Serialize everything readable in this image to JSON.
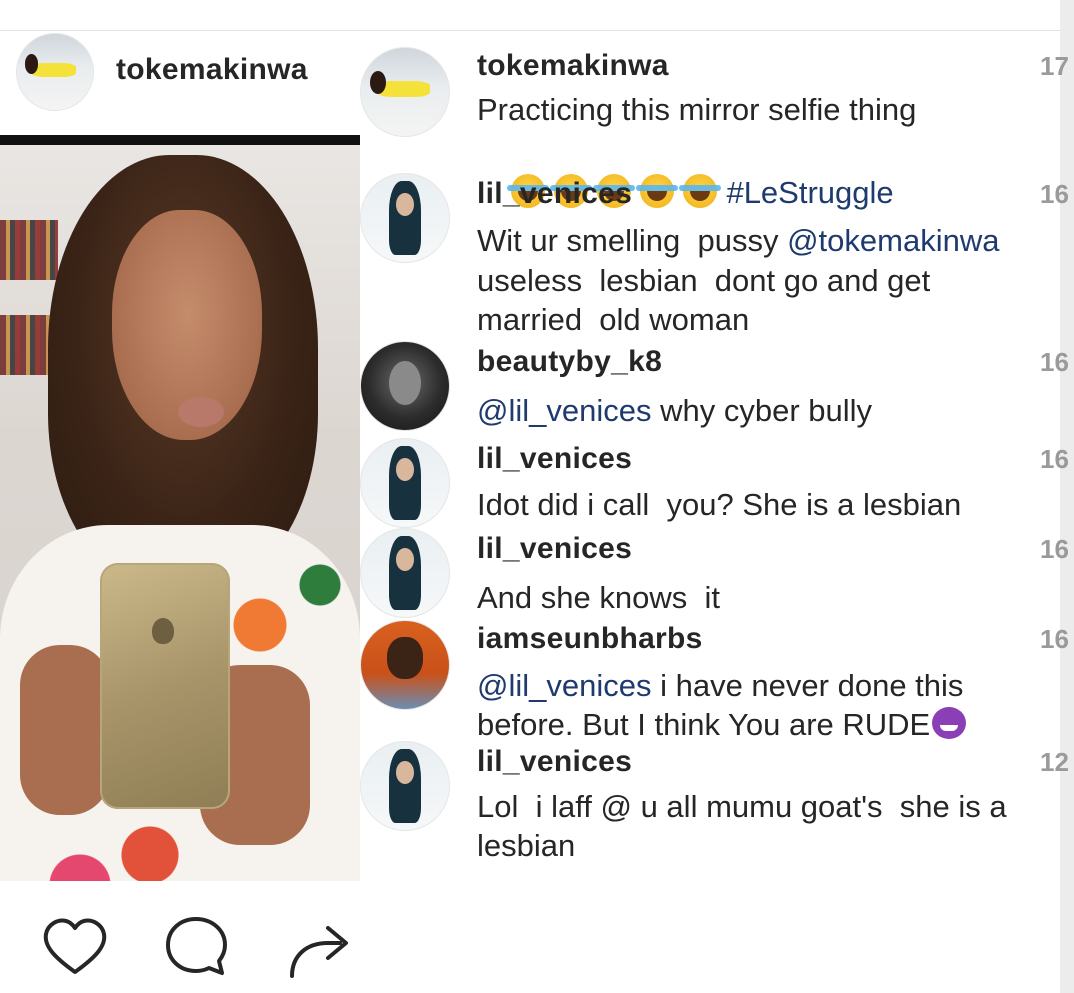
{
  "post": {
    "header": {
      "username": "tokemakinwa"
    },
    "photo": {
      "description": ""
    }
  },
  "comments": [
    {
      "username": "tokemakinwa",
      "time": "17",
      "avatar": "toke",
      "lines": [
        "Practicing this mirror selfie thing"
      ],
      "caption_hashtag": "#LeStruggle",
      "emoji_count": 5
    },
    {
      "username": "lil_venices",
      "time": "16",
      "avatar": "lil",
      "line1_text": "Wit ur smelling  pussy ",
      "line1_mention": "@tokemakinwa",
      "lines_rest": [
        "useless  lesbian  dont go and get",
        "married  old woman"
      ]
    },
    {
      "username": "beautyby_k8",
      "time": "16",
      "avatar": "beauty",
      "mention": "@lil_venices",
      "text": " why cyber bully"
    },
    {
      "username": "lil_venices",
      "time": "16",
      "avatar": "lil",
      "text": "Idot did i call  you? She is a lesbian"
    },
    {
      "username": "lil_venices",
      "time": "16",
      "avatar": "lil",
      "text": "And she knows  it"
    },
    {
      "username": "iamseunbharbs",
      "time": "16",
      "avatar": "seun",
      "mention": "@lil_venices",
      "line1_text": " i have never done this",
      "line2_text": "before. But I think You are RUDE"
    },
    {
      "username": "lil_venices",
      "time": "12",
      "avatar": "lil",
      "line1_text": "Lol  i laff @ u all mumu goat's  she is a",
      "line2_text": "lesbian"
    }
  ],
  "actions": {
    "icons": [
      "heart-icon",
      "comment-icon",
      "share-icon"
    ]
  },
  "colors": {
    "mention": "#1e3a6e",
    "timestamp": "#9a9a9a",
    "text": "#262626",
    "scrollbar": "#ececec"
  }
}
